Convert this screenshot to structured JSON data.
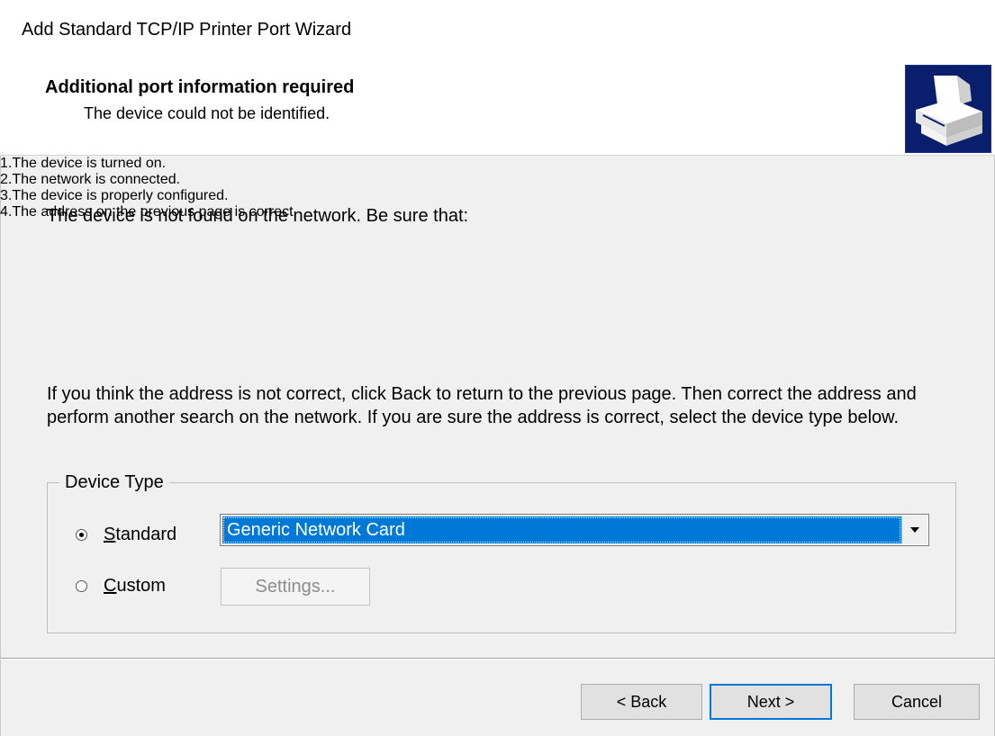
{
  "window": {
    "title": "Add Standard TCP/IP Printer Port Wizard"
  },
  "header": {
    "title": "Additional port information required",
    "subtitle": "The device could not be identified.",
    "icon": "printer-wizard-icon"
  },
  "content": {
    "intro": "The device is not found on the network.  Be sure that:",
    "checklist": [
      {
        "num": "1.",
        "text": "The device is turned on."
      },
      {
        "num": "2.",
        "text": "The network is connected."
      },
      {
        "num": "3.",
        "text": "The device is properly configured."
      },
      {
        "num": "4.",
        "text": "The address on the previous page is correct."
      }
    ],
    "advice": "If you think the address is not correct, click Back to return to the previous page.  Then correct the address and perform another search on the network.  If you are sure the address is correct, select the device type below."
  },
  "device_type": {
    "legend": "Device Type",
    "standard_label": "Standard",
    "standard_checked": true,
    "custom_label": "Custom",
    "custom_checked": false,
    "selected_device": "Generic Network Card",
    "settings_label": "Settings..."
  },
  "buttons": {
    "back": "< Back",
    "next": "Next >",
    "cancel": "Cancel"
  },
  "colors": {
    "selection": "#0078d7",
    "default_button_border": "#0078d7",
    "icon_bg": "#0a1e6e"
  }
}
